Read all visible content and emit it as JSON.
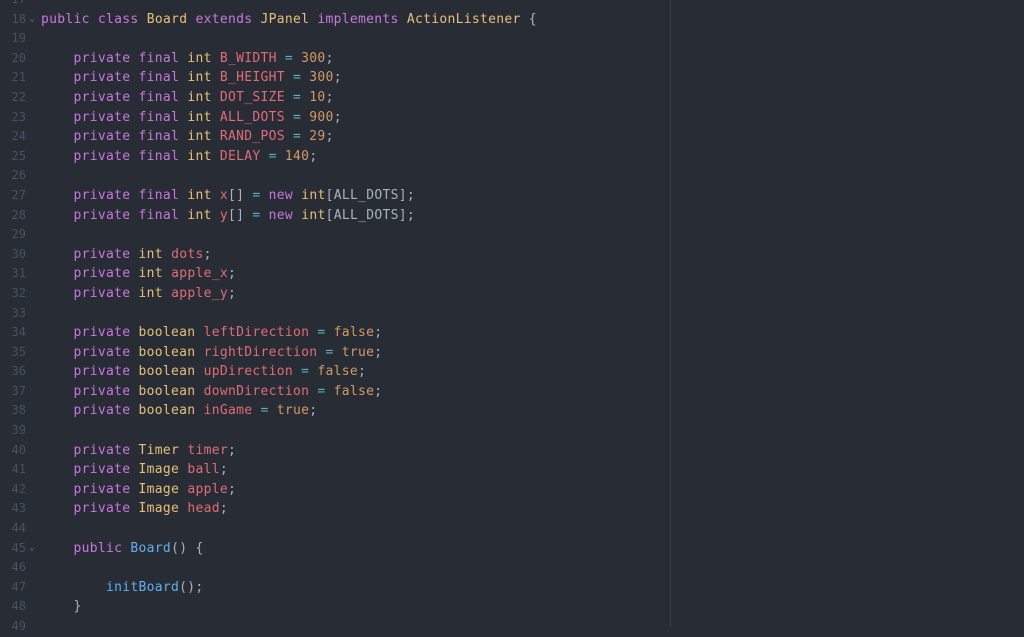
{
  "editor": {
    "language": "java",
    "theme_colors": {
      "background": "#282c34",
      "keyword": "#c678dd",
      "type": "#e5c07b",
      "variable": "#e06c75",
      "number": "#d19a66",
      "operator": "#56b6c2",
      "function": "#61afef",
      "plain": "#abb2bf",
      "gutter": "#495162"
    },
    "lines": [
      {
        "n": "17",
        "fold": "",
        "tokens": []
      },
      {
        "n": "18",
        "fold": "⌄",
        "tokens": [
          [
            "kw",
            "public"
          ],
          [
            "plain",
            " "
          ],
          [
            "kw",
            "class"
          ],
          [
            "plain",
            " "
          ],
          [
            "type",
            "Board"
          ],
          [
            "plain",
            " "
          ],
          [
            "kw",
            "extends"
          ],
          [
            "plain",
            " "
          ],
          [
            "type",
            "JPanel"
          ],
          [
            "plain",
            " "
          ],
          [
            "kw",
            "implements"
          ],
          [
            "plain",
            " "
          ],
          [
            "type",
            "ActionListener"
          ],
          [
            "plain",
            " {"
          ]
        ]
      },
      {
        "n": "19",
        "fold": "",
        "tokens": []
      },
      {
        "n": "20",
        "fold": "",
        "tokens": [
          [
            "plain",
            "    "
          ],
          [
            "kw",
            "private"
          ],
          [
            "plain",
            " "
          ],
          [
            "kw",
            "final"
          ],
          [
            "plain",
            " "
          ],
          [
            "type",
            "int"
          ],
          [
            "plain",
            " "
          ],
          [
            "var",
            "B_WIDTH"
          ],
          [
            "plain",
            " "
          ],
          [
            "op",
            "="
          ],
          [
            "plain",
            " "
          ],
          [
            "num",
            "300"
          ],
          [
            "plain",
            ";"
          ]
        ]
      },
      {
        "n": "21",
        "fold": "",
        "tokens": [
          [
            "plain",
            "    "
          ],
          [
            "kw",
            "private"
          ],
          [
            "plain",
            " "
          ],
          [
            "kw",
            "final"
          ],
          [
            "plain",
            " "
          ],
          [
            "type",
            "int"
          ],
          [
            "plain",
            " "
          ],
          [
            "var",
            "B_HEIGHT"
          ],
          [
            "plain",
            " "
          ],
          [
            "op",
            "="
          ],
          [
            "plain",
            " "
          ],
          [
            "num",
            "300"
          ],
          [
            "plain",
            ";"
          ]
        ]
      },
      {
        "n": "22",
        "fold": "",
        "tokens": [
          [
            "plain",
            "    "
          ],
          [
            "kw",
            "private"
          ],
          [
            "plain",
            " "
          ],
          [
            "kw",
            "final"
          ],
          [
            "plain",
            " "
          ],
          [
            "type",
            "int"
          ],
          [
            "plain",
            " "
          ],
          [
            "var",
            "DOT_SIZE"
          ],
          [
            "plain",
            " "
          ],
          [
            "op",
            "="
          ],
          [
            "plain",
            " "
          ],
          [
            "num",
            "10"
          ],
          [
            "plain",
            ";"
          ]
        ]
      },
      {
        "n": "23",
        "fold": "",
        "tokens": [
          [
            "plain",
            "    "
          ],
          [
            "kw",
            "private"
          ],
          [
            "plain",
            " "
          ],
          [
            "kw",
            "final"
          ],
          [
            "plain",
            " "
          ],
          [
            "type",
            "int"
          ],
          [
            "plain",
            " "
          ],
          [
            "var",
            "ALL_DOTS"
          ],
          [
            "plain",
            " "
          ],
          [
            "op",
            "="
          ],
          [
            "plain",
            " "
          ],
          [
            "num",
            "900"
          ],
          [
            "plain",
            ";"
          ]
        ]
      },
      {
        "n": "24",
        "fold": "",
        "tokens": [
          [
            "plain",
            "    "
          ],
          [
            "kw",
            "private"
          ],
          [
            "plain",
            " "
          ],
          [
            "kw",
            "final"
          ],
          [
            "plain",
            " "
          ],
          [
            "type",
            "int"
          ],
          [
            "plain",
            " "
          ],
          [
            "var",
            "RAND_POS"
          ],
          [
            "plain",
            " "
          ],
          [
            "op",
            "="
          ],
          [
            "plain",
            " "
          ],
          [
            "num",
            "29"
          ],
          [
            "plain",
            ";"
          ]
        ]
      },
      {
        "n": "25",
        "fold": "",
        "tokens": [
          [
            "plain",
            "    "
          ],
          [
            "kw",
            "private"
          ],
          [
            "plain",
            " "
          ],
          [
            "kw",
            "final"
          ],
          [
            "plain",
            " "
          ],
          [
            "type",
            "int"
          ],
          [
            "plain",
            " "
          ],
          [
            "var",
            "DELAY"
          ],
          [
            "plain",
            " "
          ],
          [
            "op",
            "="
          ],
          [
            "plain",
            " "
          ],
          [
            "num",
            "140"
          ],
          [
            "plain",
            ";"
          ]
        ]
      },
      {
        "n": "26",
        "fold": "",
        "tokens": []
      },
      {
        "n": "27",
        "fold": "",
        "tokens": [
          [
            "plain",
            "    "
          ],
          [
            "kw",
            "private"
          ],
          [
            "plain",
            " "
          ],
          [
            "kw",
            "final"
          ],
          [
            "plain",
            " "
          ],
          [
            "type",
            "int"
          ],
          [
            "plain",
            " "
          ],
          [
            "var",
            "x"
          ],
          [
            "plain",
            "[] "
          ],
          [
            "op",
            "="
          ],
          [
            "plain",
            " "
          ],
          [
            "kw",
            "new"
          ],
          [
            "plain",
            " "
          ],
          [
            "type",
            "int"
          ],
          [
            "plain",
            "[ALL_DOTS];"
          ]
        ]
      },
      {
        "n": "28",
        "fold": "",
        "tokens": [
          [
            "plain",
            "    "
          ],
          [
            "kw",
            "private"
          ],
          [
            "plain",
            " "
          ],
          [
            "kw",
            "final"
          ],
          [
            "plain",
            " "
          ],
          [
            "type",
            "int"
          ],
          [
            "plain",
            " "
          ],
          [
            "var",
            "y"
          ],
          [
            "plain",
            "[] "
          ],
          [
            "op",
            "="
          ],
          [
            "plain",
            " "
          ],
          [
            "kw",
            "new"
          ],
          [
            "plain",
            " "
          ],
          [
            "type",
            "int"
          ],
          [
            "plain",
            "[ALL_DOTS];"
          ]
        ]
      },
      {
        "n": "29",
        "fold": "",
        "tokens": []
      },
      {
        "n": "30",
        "fold": "",
        "tokens": [
          [
            "plain",
            "    "
          ],
          [
            "kw",
            "private"
          ],
          [
            "plain",
            " "
          ],
          [
            "type",
            "int"
          ],
          [
            "plain",
            " "
          ],
          [
            "var",
            "dots"
          ],
          [
            "plain",
            ";"
          ]
        ]
      },
      {
        "n": "31",
        "fold": "",
        "tokens": [
          [
            "plain",
            "    "
          ],
          [
            "kw",
            "private"
          ],
          [
            "plain",
            " "
          ],
          [
            "type",
            "int"
          ],
          [
            "plain",
            " "
          ],
          [
            "var",
            "apple_x"
          ],
          [
            "plain",
            ";"
          ]
        ]
      },
      {
        "n": "32",
        "fold": "",
        "tokens": [
          [
            "plain",
            "    "
          ],
          [
            "kw",
            "private"
          ],
          [
            "plain",
            " "
          ],
          [
            "type",
            "int"
          ],
          [
            "plain",
            " "
          ],
          [
            "var",
            "apple_y"
          ],
          [
            "plain",
            ";"
          ]
        ]
      },
      {
        "n": "33",
        "fold": "",
        "tokens": []
      },
      {
        "n": "34",
        "fold": "",
        "tokens": [
          [
            "plain",
            "    "
          ],
          [
            "kw",
            "private"
          ],
          [
            "plain",
            " "
          ],
          [
            "type",
            "boolean"
          ],
          [
            "plain",
            " "
          ],
          [
            "var",
            "leftDirection"
          ],
          [
            "plain",
            " "
          ],
          [
            "op",
            "="
          ],
          [
            "plain",
            " "
          ],
          [
            "num",
            "false"
          ],
          [
            "plain",
            ";"
          ]
        ]
      },
      {
        "n": "35",
        "fold": "",
        "tokens": [
          [
            "plain",
            "    "
          ],
          [
            "kw",
            "private"
          ],
          [
            "plain",
            " "
          ],
          [
            "type",
            "boolean"
          ],
          [
            "plain",
            " "
          ],
          [
            "var",
            "rightDirection"
          ],
          [
            "plain",
            " "
          ],
          [
            "op",
            "="
          ],
          [
            "plain",
            " "
          ],
          [
            "num",
            "true"
          ],
          [
            "plain",
            ";"
          ]
        ]
      },
      {
        "n": "36",
        "fold": "",
        "tokens": [
          [
            "plain",
            "    "
          ],
          [
            "kw",
            "private"
          ],
          [
            "plain",
            " "
          ],
          [
            "type",
            "boolean"
          ],
          [
            "plain",
            " "
          ],
          [
            "var",
            "upDirection"
          ],
          [
            "plain",
            " "
          ],
          [
            "op",
            "="
          ],
          [
            "plain",
            " "
          ],
          [
            "num",
            "false"
          ],
          [
            "plain",
            ";"
          ]
        ]
      },
      {
        "n": "37",
        "fold": "",
        "tokens": [
          [
            "plain",
            "    "
          ],
          [
            "kw",
            "private"
          ],
          [
            "plain",
            " "
          ],
          [
            "type",
            "boolean"
          ],
          [
            "plain",
            " "
          ],
          [
            "var",
            "downDirection"
          ],
          [
            "plain",
            " "
          ],
          [
            "op",
            "="
          ],
          [
            "plain",
            " "
          ],
          [
            "num",
            "false"
          ],
          [
            "plain",
            ";"
          ]
        ]
      },
      {
        "n": "38",
        "fold": "",
        "tokens": [
          [
            "plain",
            "    "
          ],
          [
            "kw",
            "private"
          ],
          [
            "plain",
            " "
          ],
          [
            "type",
            "boolean"
          ],
          [
            "plain",
            " "
          ],
          [
            "var",
            "inGame"
          ],
          [
            "plain",
            " "
          ],
          [
            "op",
            "="
          ],
          [
            "plain",
            " "
          ],
          [
            "num",
            "true"
          ],
          [
            "plain",
            ";"
          ]
        ]
      },
      {
        "n": "39",
        "fold": "",
        "tokens": []
      },
      {
        "n": "40",
        "fold": "",
        "tokens": [
          [
            "plain",
            "    "
          ],
          [
            "kw",
            "private"
          ],
          [
            "plain",
            " "
          ],
          [
            "type",
            "Timer"
          ],
          [
            "plain",
            " "
          ],
          [
            "var",
            "timer"
          ],
          [
            "plain",
            ";"
          ]
        ]
      },
      {
        "n": "41",
        "fold": "",
        "tokens": [
          [
            "plain",
            "    "
          ],
          [
            "kw",
            "private"
          ],
          [
            "plain",
            " "
          ],
          [
            "type",
            "Image"
          ],
          [
            "plain",
            " "
          ],
          [
            "var",
            "ball"
          ],
          [
            "plain",
            ";"
          ]
        ]
      },
      {
        "n": "42",
        "fold": "",
        "tokens": [
          [
            "plain",
            "    "
          ],
          [
            "kw",
            "private"
          ],
          [
            "plain",
            " "
          ],
          [
            "type",
            "Image"
          ],
          [
            "plain",
            " "
          ],
          [
            "var",
            "apple"
          ],
          [
            "plain",
            ";"
          ]
        ]
      },
      {
        "n": "43",
        "fold": "",
        "tokens": [
          [
            "plain",
            "    "
          ],
          [
            "kw",
            "private"
          ],
          [
            "plain",
            " "
          ],
          [
            "type",
            "Image"
          ],
          [
            "plain",
            " "
          ],
          [
            "var",
            "head"
          ],
          [
            "plain",
            ";"
          ]
        ]
      },
      {
        "n": "44",
        "fold": "",
        "tokens": []
      },
      {
        "n": "45",
        "fold": "⌄",
        "tokens": [
          [
            "plain",
            "    "
          ],
          [
            "kw",
            "public"
          ],
          [
            "plain",
            " "
          ],
          [
            "fn",
            "Board"
          ],
          [
            "plain",
            "() {"
          ]
        ]
      },
      {
        "n": "46",
        "fold": "",
        "tokens": []
      },
      {
        "n": "47",
        "fold": "",
        "tokens": [
          [
            "plain",
            "        "
          ],
          [
            "fn",
            "initBoard"
          ],
          [
            "plain",
            "();"
          ]
        ]
      },
      {
        "n": "48",
        "fold": "",
        "tokens": [
          [
            "plain",
            "    }"
          ]
        ]
      },
      {
        "n": "49",
        "fold": "",
        "tokens": []
      }
    ]
  }
}
